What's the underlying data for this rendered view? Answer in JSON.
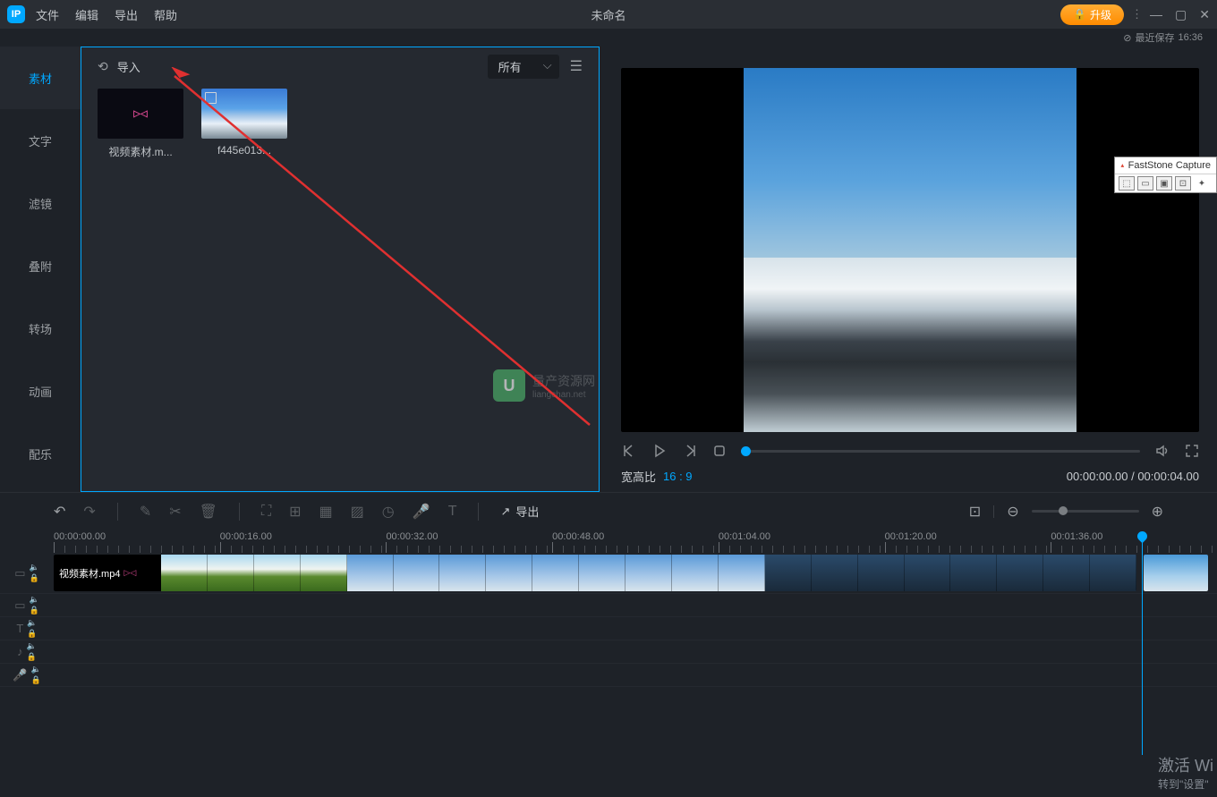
{
  "titlebar": {
    "menus": [
      "文件",
      "编辑",
      "导出",
      "帮助"
    ],
    "title": "未命名",
    "upgrade": "升级",
    "last_save_label": "最近保存",
    "last_save_time": "16:36"
  },
  "sidebar": {
    "tabs": [
      "素材",
      "文字",
      "滤镜",
      "叠附",
      "转场",
      "动画",
      "配乐"
    ]
  },
  "media_panel": {
    "import_label": "导入",
    "filter_selected": "所有",
    "items": [
      {
        "name": "视频素材.m...",
        "kind": "video-dark"
      },
      {
        "name": "f445e013...",
        "kind": "photo-sky"
      }
    ]
  },
  "watermark": {
    "logo": "U",
    "text": "量产资源网",
    "subtext": "liangchan.net"
  },
  "preview": {
    "aspect_label": "宽高比",
    "aspect_value": "16 : 9",
    "time_current": "00:00:00.00",
    "time_total": "00:00:04.00"
  },
  "toolbar": {
    "export_label": "导出"
  },
  "timeline": {
    "ruler": [
      "00:00:00.00",
      "00:00:16.00",
      "00:00:32.00",
      "00:00:48.00",
      "00:01:04.00",
      "00:01:20.00",
      "00:01:36.00"
    ],
    "video_clip_label": "视频素材.mp4"
  },
  "faststone": {
    "title": "FastStone Capture"
  },
  "windows_activate": {
    "line1": "激活 Wi",
    "line2": "转到\"设置\""
  }
}
